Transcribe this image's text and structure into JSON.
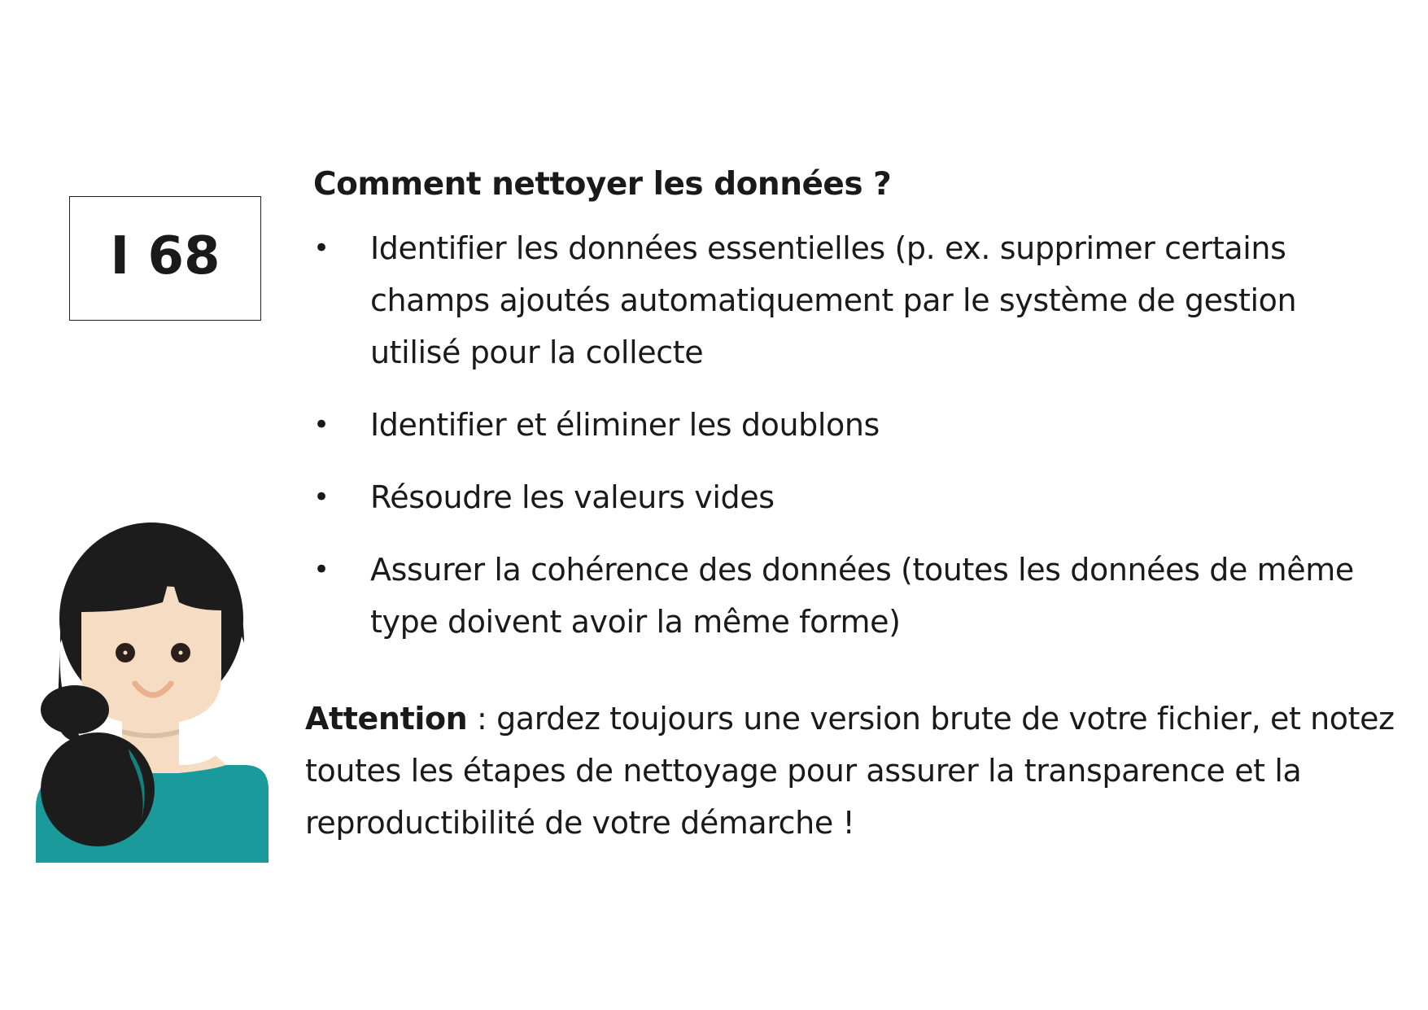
{
  "card": {
    "code": "I 68"
  },
  "main": {
    "heading": "Comment nettoyer les données ?",
    "bullet_symbol": "•",
    "items": [
      "Identifier les données essentielles (p. ex. supprimer certains champs ajoutés automatiquement par le système de gestion utilisé pour la collecte",
      "Identifier et éliminer les doublons",
      "Résoudre les valeurs vides",
      "Assurer la cohérence des données (toutes les données de même type doivent avoir la même forme)"
    ]
  },
  "note": {
    "label": "Attention",
    "text": " : gardez toujours une version brute de votre fichier, et notez toutes les étapes de nettoyage pour assurer la transparence et la reproductibilité de votre démarche !"
  },
  "illustration": {
    "icon": "woman-avatar-icon",
    "colors": {
      "hair": "#1c1c1c",
      "skin": "#f5dcc2",
      "shirt": "#1a9a9a",
      "shirt_shadow": "#167f80",
      "smile": "#e8b08c"
    }
  }
}
